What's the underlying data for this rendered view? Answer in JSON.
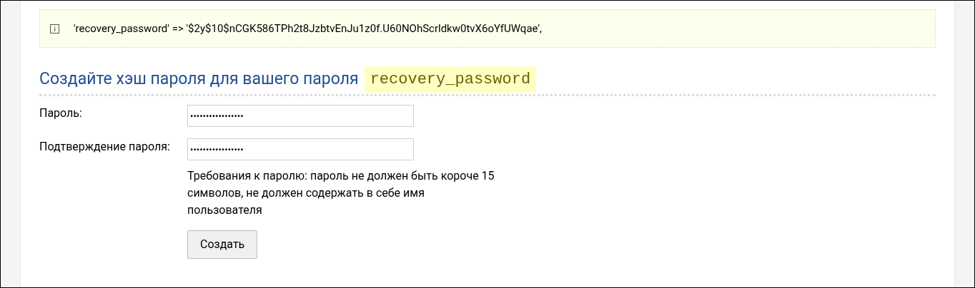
{
  "notice": {
    "text": "'recovery_password' => '$2y$10$nCGK586TPh2t8JzbtvEnJu1z0f.U60NOhScrldkw0tvX6oYfUWqae',"
  },
  "heading": {
    "text": "Создайте хэш пароля для вашего пароля",
    "code": "recovery_password"
  },
  "fields": [
    {
      "label": "Пароль:",
      "value": "•••••••••••••••••"
    },
    {
      "label": "Подтверждение пароля:",
      "value": "•••••••••••••••••"
    }
  ],
  "hint": "Требования к паролю: пароль не должен быть короче 15 символов, не должен содержать в себе имя пользователя",
  "submit_button": "Создать"
}
